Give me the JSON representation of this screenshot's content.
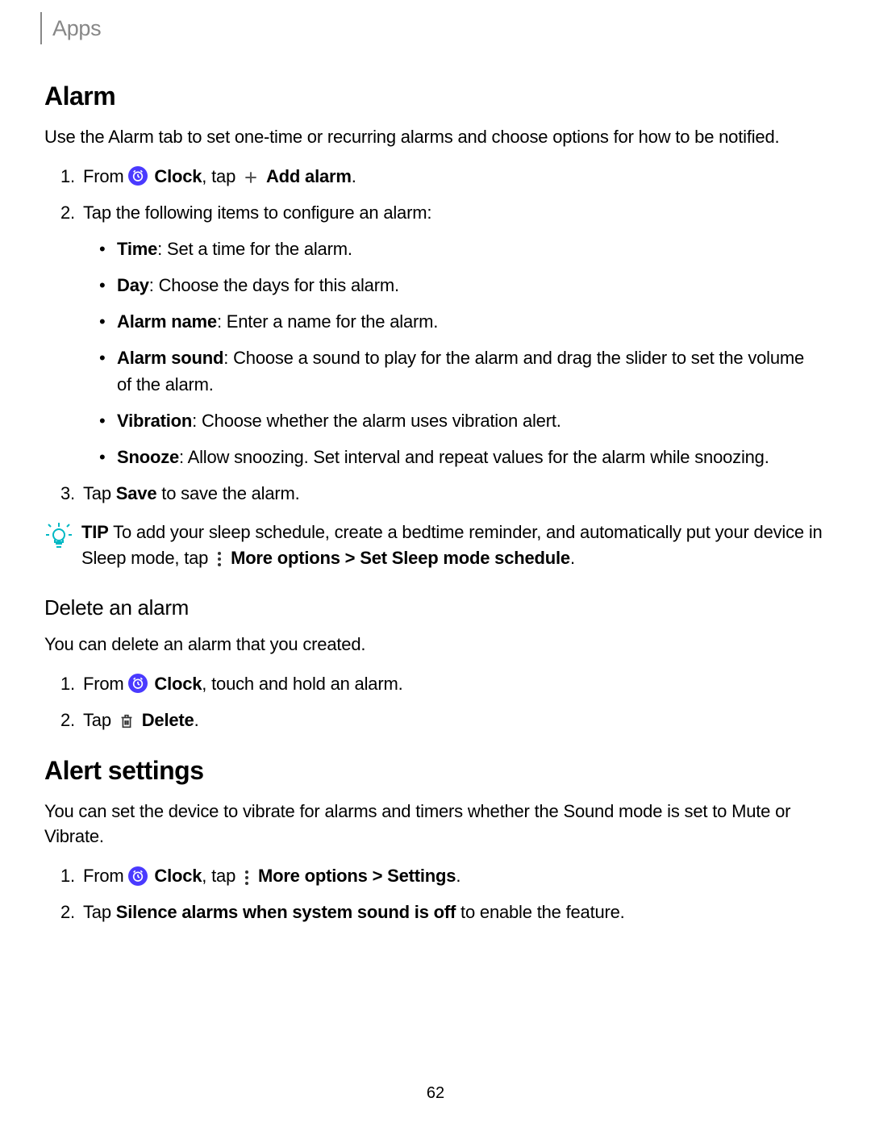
{
  "breadcrumb": "Apps",
  "section1": {
    "heading": "Alarm",
    "intro": "Use the Alarm tab to set one-time or recurring alarms and choose options for how to be notified.",
    "step1_from": "From ",
    "step1_clock": "Clock",
    "step1_tap": ", tap ",
    "step1_addalarm": "Add alarm",
    "step1_period": ".",
    "step2": "Tap the following items to configure an alarm:",
    "bullets": {
      "time_label": "Time",
      "time_text": ": Set a time for the alarm.",
      "day_label": "Day",
      "day_text": ": Choose the days for this alarm.",
      "name_label": "Alarm name",
      "name_text": ": Enter a name for the alarm.",
      "sound_label": "Alarm sound",
      "sound_text": ": Choose a sound to play for the alarm and drag the slider to set the volume of the alarm.",
      "vibration_label": "Vibration",
      "vibration_text": ": Choose whether the alarm uses vibration alert.",
      "snooze_label": "Snooze",
      "snooze_text": ": Allow snoozing. Set interval and repeat values for the alarm while snoozing."
    },
    "step3_tap": "Tap ",
    "step3_save": "Save",
    "step3_text": " to save the alarm.",
    "tip_label": "TIP",
    "tip_text1": "  To add your sleep schedule, create a bedtime reminder, and automatically put your device in Sleep mode, tap ",
    "tip_more": "More options > Set Sleep mode schedule",
    "tip_period": "."
  },
  "section2": {
    "heading": "Delete an alarm",
    "intro": "You can delete an alarm that you created.",
    "step1_from": "From ",
    "step1_clock": "Clock",
    "step1_text": ", touch and hold an alarm.",
    "step2_tap": "Tap ",
    "step2_delete": "Delete",
    "step2_period": "."
  },
  "section3": {
    "heading": "Alert settings",
    "intro": "You can set the device to vibrate for alarms and timers whether the Sound mode is set to Mute or Vibrate.",
    "step1_from": "From ",
    "step1_clock": "Clock",
    "step1_tap": ", tap ",
    "step1_more": "More options > Settings",
    "step1_period": ".",
    "step2_tap": "Tap ",
    "step2_silence": "Silence alarms when system sound is off",
    "step2_text": " to enable the feature."
  },
  "pageNumber": "62"
}
